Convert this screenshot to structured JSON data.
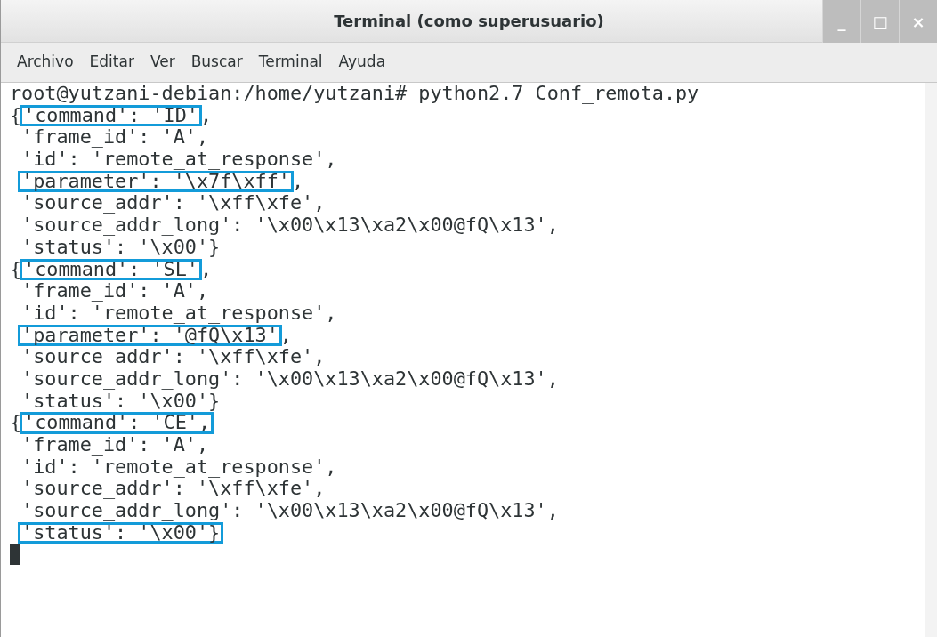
{
  "window": {
    "title": "Terminal (como superusuario)",
    "controls": [
      "_",
      "□",
      "×"
    ]
  },
  "menu": [
    "Archivo",
    "Editar",
    "Ver",
    "Buscar",
    "Terminal",
    "Ayuda"
  ],
  "terminal": {
    "cursor_visible": true,
    "lines": [
      {
        "segments": [
          {
            "text": "root@yutzani-debian:/home/yutzani# python2.7 Conf_remota.py",
            "highlighted": false
          }
        ]
      },
      {
        "segments": [
          {
            "text": "{",
            "highlighted": false
          },
          {
            "text": "'command': 'ID'",
            "highlighted": true
          },
          {
            "text": ",",
            "highlighted": false
          }
        ]
      },
      {
        "segments": [
          {
            "text": " 'frame_id': 'A',",
            "highlighted": false
          }
        ]
      },
      {
        "segments": [
          {
            "text": " 'id': 'remote_at_response',",
            "highlighted": false
          }
        ]
      },
      {
        "segments": [
          {
            "text": "'parameter': '\\x7f\\xff'",
            "highlighted": true
          },
          {
            "text": ",",
            "highlighted": false
          }
        ]
      },
      {
        "segments": [
          {
            "text": " 'source_addr': '\\xff\\xfe',",
            "highlighted": false
          }
        ]
      },
      {
        "segments": [
          {
            "text": " 'source_addr_long': '\\x00\\x13\\xa2\\x00@fQ\\x13',",
            "highlighted": false
          }
        ]
      },
      {
        "segments": [
          {
            "text": " 'status': '\\x00'}",
            "highlighted": false
          }
        ]
      },
      {
        "segments": [
          {
            "text": "{",
            "highlighted": false
          },
          {
            "text": "'command': 'SL'",
            "highlighted": true
          },
          {
            "text": ",",
            "highlighted": false
          }
        ]
      },
      {
        "segments": [
          {
            "text": " 'frame_id': 'A',",
            "highlighted": false
          }
        ]
      },
      {
        "segments": [
          {
            "text": " 'id': 'remote_at_response',",
            "highlighted": false
          }
        ]
      },
      {
        "segments": [
          {
            "text": "'parameter': '@fQ\\x13'",
            "highlighted": true
          },
          {
            "text": ",",
            "highlighted": false
          }
        ]
      },
      {
        "segments": [
          {
            "text": " 'source_addr': '\\xff\\xfe',",
            "highlighted": false
          }
        ]
      },
      {
        "segments": [
          {
            "text": " 'source_addr_long': '\\x00\\x13\\xa2\\x00@fQ\\x13',",
            "highlighted": false
          }
        ]
      },
      {
        "segments": [
          {
            "text": " 'status': '\\x00'}",
            "highlighted": false
          }
        ]
      },
      {
        "segments": [
          {
            "text": "{",
            "highlighted": false
          },
          {
            "text": "'command': 'CE',",
            "highlighted": true
          }
        ]
      },
      {
        "segments": [
          {
            "text": " 'frame_id': 'A',",
            "highlighted": false
          }
        ]
      },
      {
        "segments": [
          {
            "text": " 'id': 'remote_at_response',",
            "highlighted": false
          }
        ]
      },
      {
        "segments": [
          {
            "text": " 'source_addr': '\\xff\\xfe',",
            "highlighted": false
          }
        ]
      },
      {
        "segments": [
          {
            "text": " 'source_addr_long': '\\x00\\x13\\xa2\\x00@fQ\\x13',",
            "highlighted": false
          }
        ]
      },
      {
        "segments": [
          {
            "text": "'status': '\\x00'}",
            "highlighted": true
          }
        ]
      }
    ]
  }
}
